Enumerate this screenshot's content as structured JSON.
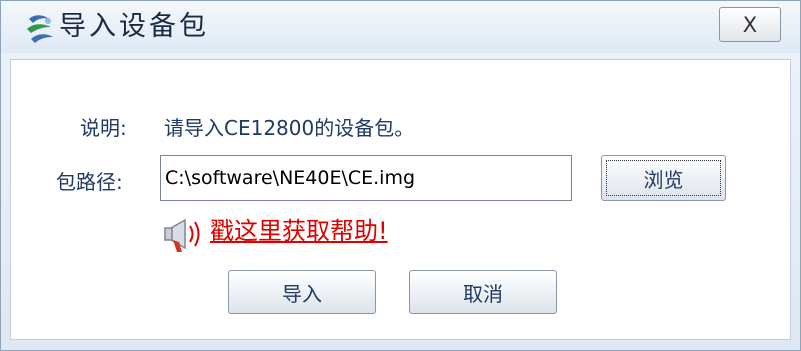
{
  "window": {
    "title": "导入设备包",
    "close_label": "X"
  },
  "form": {
    "description_label": "说明:",
    "description_text": "请导入CE12800的设备包。",
    "path_label": "包路径:",
    "path_value": "C:\\software\\NE40E\\CE.img",
    "browse_label": "浏览",
    "help_link": "戳这里获取帮助!",
    "import_label": "导入",
    "cancel_label": "取消"
  },
  "icons": {
    "app": "package-import-icon",
    "help": "megaphone-icon"
  },
  "colors": {
    "link": "#e00000",
    "label_text": "#1f3a63"
  }
}
